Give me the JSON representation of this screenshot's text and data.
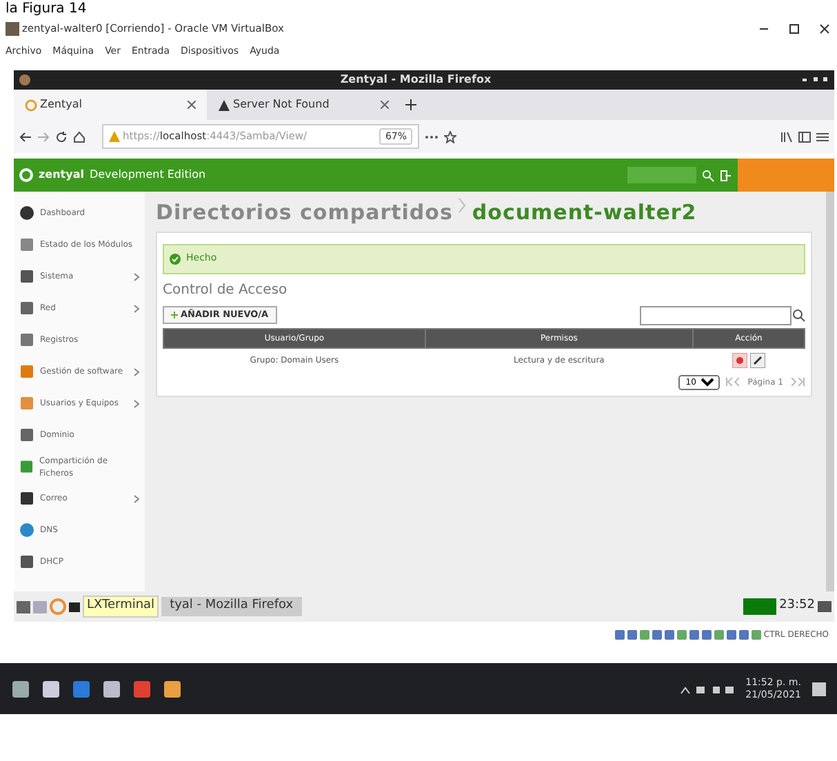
{
  "document_caption": "la Figura 14",
  "vm_window": {
    "title": "zentyal-walter0 [Corriendo] - Oracle VM VirtualBox",
    "menu": [
      "Archivo",
      "Máquina",
      "Ver",
      "Entrada",
      "Dispositivos",
      "Ayuda"
    ]
  },
  "browser": {
    "title": "Zentyal - Mozilla Firefox",
    "tabs": [
      {
        "label": "Zentyal",
        "selected": true
      },
      {
        "label": "Server Not Found",
        "selected": false
      }
    ],
    "url": "https://localhost:4443/Samba/View/",
    "zoom": "67%"
  },
  "app": {
    "brand": "zentyal",
    "edition": "Development Edition",
    "sidebar": [
      {
        "label": "Dashboard",
        "has_submenu": false
      },
      {
        "label": "Estado de los Módulos",
        "has_submenu": false
      },
      {
        "label": "Sistema",
        "has_submenu": true
      },
      {
        "label": "Red",
        "has_submenu": true
      },
      {
        "label": "Registros",
        "has_submenu": false
      },
      {
        "label": "Gestión de software",
        "has_submenu": true
      },
      {
        "label": "Usuarios y Equipos",
        "has_submenu": true
      },
      {
        "label": "Dominio",
        "has_submenu": false
      },
      {
        "label": "Compartición de Ficheros",
        "has_submenu": false
      },
      {
        "label": "Correo",
        "has_submenu": true
      },
      {
        "label": "DNS",
        "has_submenu": false
      },
      {
        "label": "DHCP",
        "has_submenu": false
      }
    ],
    "breadcrumb": [
      "Directorios compartidos",
      "document-walter2"
    ],
    "alert": "Hecho",
    "section": "Control de Acceso",
    "add_button": "AÑADIR NUEVO/A",
    "columns": [
      "Usuario/Grupo",
      "Permisos",
      "Acción"
    ],
    "rows": [
      {
        "cells": [
          "Grupo: Domain Users",
          "Lectura y de escritura"
        ]
      }
    ],
    "page_size": "10",
    "page_label": "Página 1"
  },
  "guest_panel": {
    "tooltip": "LXTerminal",
    "task": "tyal - Mozilla Firefox",
    "clock": "23:52"
  },
  "vm_status": {
    "host_key": "CTRL DERECHO"
  },
  "host_taskbar": {
    "time": "11:52 p. m.",
    "date": "21/05/2021"
  }
}
